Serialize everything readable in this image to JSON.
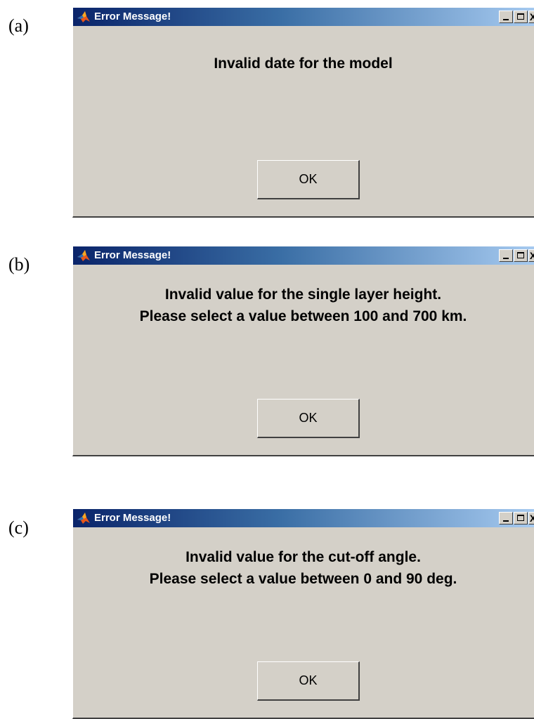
{
  "panels": [
    {
      "label": "(a)",
      "window": {
        "title": "Error Message!",
        "minimize": "_",
        "close": "X"
      },
      "message_lines": [
        "Invalid date for the model"
      ],
      "button": "OK"
    },
    {
      "label": "(b)",
      "window": {
        "title": "Error Message!",
        "minimize": "_",
        "close": "X"
      },
      "message_lines": [
        "Invalid value for the single layer height.",
        "Please select a value between 100 and 700 km."
      ],
      "button": "OK"
    },
    {
      "label": "(c)",
      "window": {
        "title": "Error Message!",
        "minimize": "_",
        "close": "X"
      },
      "message_lines": [
        "Invalid value for the cut-off angle.",
        "Please select a value between 0 and 90 deg."
      ],
      "button": "OK"
    }
  ],
  "colors": {
    "dialog_bg": "#d4d0c8",
    "title_start": "#0a246a",
    "title_end": "#a6caf0"
  },
  "icons": {
    "app": "matlab-icon",
    "minimize": "minimize-icon",
    "maximize": "maximize-icon",
    "close": "close-icon"
  }
}
